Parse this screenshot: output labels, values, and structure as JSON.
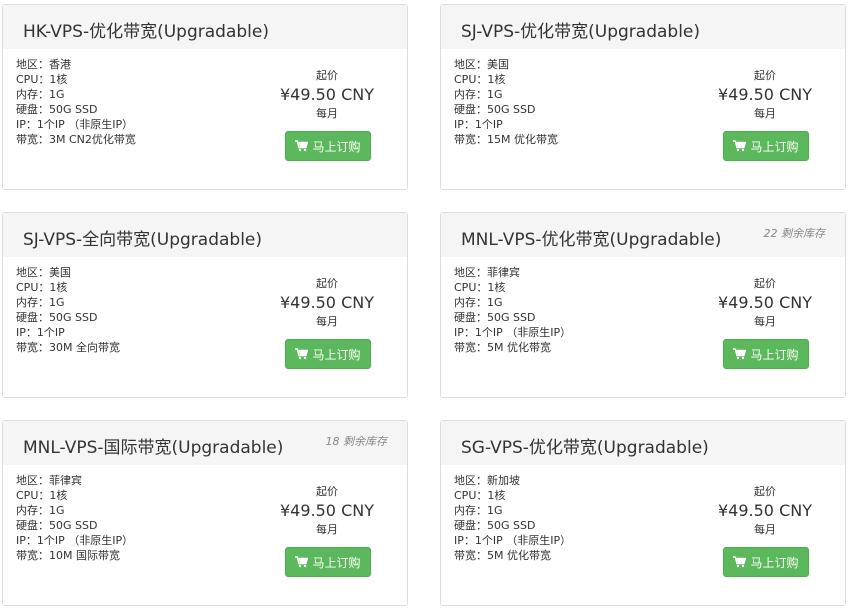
{
  "colors": {
    "button_bg": "#5cb85c",
    "header_bg": "#f5f5f5",
    "border": "#dddddd",
    "stock_text": "#888888"
  },
  "icons": {
    "order_button": "shopping-cart-icon"
  },
  "products": [
    {
      "title": "HK-VPS-优化带宽(Upgradable)",
      "stock": "",
      "specs": [
        "地区：香港",
        "CPU：1核",
        "内存：1G",
        "硬盘：50G SSD",
        "IP：1个IP （非原生IP）",
        "带宽：3M CN2优化带宽"
      ],
      "price_from": "起价",
      "price": "¥49.50 CNY",
      "cycle": "每月",
      "button": "马上订购"
    },
    {
      "title": "SJ-VPS-优化带宽(Upgradable)",
      "stock": "",
      "specs": [
        "地区：美国",
        "CPU：1核",
        "内存：1G",
        "硬盘：50G SSD",
        "IP：1个IP",
        "带宽：15M 优化带宽"
      ],
      "price_from": "起价",
      "price": "¥49.50 CNY",
      "cycle": "每月",
      "button": "马上订购"
    },
    {
      "title": "SJ-VPS-全向带宽(Upgradable)",
      "stock": "",
      "specs": [
        "地区：美国",
        "CPU：1核",
        "内存：1G",
        "硬盘：50G SSD",
        "IP：1个IP",
        "带宽：30M 全向带宽"
      ],
      "price_from": "起价",
      "price": "¥49.50 CNY",
      "cycle": "每月",
      "button": "马上订购"
    },
    {
      "title": "MNL-VPS-优化带宽(Upgradable)",
      "stock": "22 剩余库存",
      "specs": [
        "地区：菲律宾",
        "CPU：1核",
        "内存：1G",
        "硬盘：50G SSD",
        "IP：1个IP （非原生IP）",
        "带宽：5M 优化带宽"
      ],
      "price_from": "起价",
      "price": "¥49.50 CNY",
      "cycle": "每月",
      "button": "马上订购"
    },
    {
      "title": "MNL-VPS-国际带宽(Upgradable)",
      "stock": "18 剩余库存",
      "specs": [
        "地区：菲律宾",
        "CPU：1核",
        "内存：1G",
        "硬盘：50G SSD",
        "IP：1个IP （非原生IP）",
        "带宽：10M 国际带宽"
      ],
      "price_from": "起价",
      "price": "¥49.50 CNY",
      "cycle": "每月",
      "button": "马上订购"
    },
    {
      "title": "SG-VPS-优化带宽(Upgradable)",
      "stock": "",
      "specs": [
        "地区：新加坡",
        "CPU：1核",
        "内存：1G",
        "硬盘：50G SSD",
        "IP：1个IP （非原生IP）",
        "带宽：5M 优化带宽"
      ],
      "price_from": "起价",
      "price": "¥49.50 CNY",
      "cycle": "每月",
      "button": "马上订购"
    }
  ]
}
